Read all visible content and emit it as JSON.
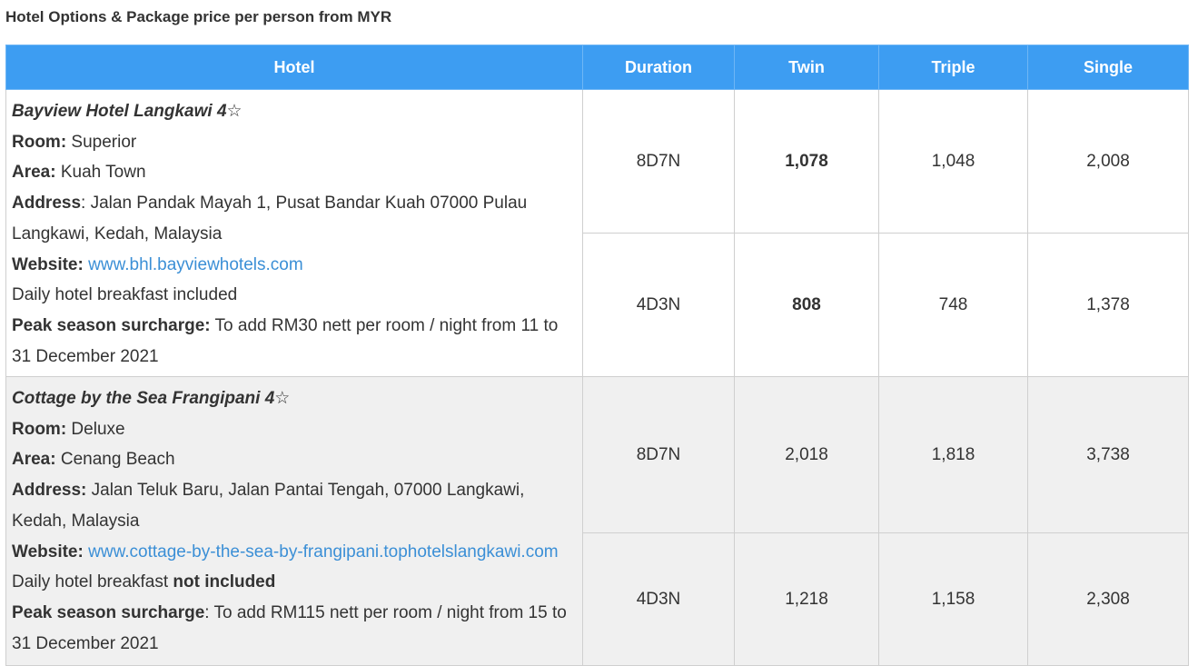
{
  "title": "Hotel Options & Package price per person from MYR",
  "table": {
    "headers": {
      "hotel": "Hotel",
      "duration": "Duration",
      "twin": "Twin",
      "triple": "Triple",
      "single": "Single"
    },
    "hotels": [
      {
        "name": "Bayview Hotel Langkawi 4☆",
        "room_label": "Room:",
        "room": " Superior",
        "area_label": "Area:",
        "area": " Kuah Town",
        "address_label": "Address",
        "address": ": Jalan Pandak Mayah 1, Pusat Bandar Kuah 07000 Pulau Langkawi, Kedah, Malaysia",
        "website_label": "Website:",
        "website": " www.bhl.bayviewhotels.com",
        "breakfast_prefix": "Daily hotel breakfast included",
        "breakfast_bold": "",
        "surcharge_label": "Peak season surcharge:",
        "surcharge": " To add RM30 nett per room / night from 11 to 31 December 2021",
        "rows": [
          {
            "duration": "8D7N",
            "twin": "1,078",
            "triple": "1,048",
            "single": "2,008"
          },
          {
            "duration": "4D3N",
            "twin": "808",
            "triple": "748",
            "single": "1,378"
          }
        ]
      },
      {
        "name": "Cottage by the Sea Frangipani 4☆",
        "room_label": "Room:",
        "room": " Deluxe",
        "area_label": "Area:",
        "area": " Cenang Beach",
        "address_label": "Address:",
        "address": " Jalan Teluk Baru, Jalan Pantai Tengah, 07000 Langkawi, Kedah, Malaysia",
        "website_label": "Website:",
        "website": " www.cottage-by-the-sea-by-frangipani.tophotelslangkawi.com",
        "breakfast_prefix": "Daily hotel breakfast ",
        "breakfast_bold": "not included",
        "surcharge_label": "Peak season surcharge",
        "surcharge": ": To add RM115 nett per room / night from 15 to 31 December 2021",
        "rows": [
          {
            "duration": "8D7N",
            "twin": "2,018",
            "triple": "1,818",
            "single": "3,738"
          },
          {
            "duration": "4D3N",
            "twin": "1,218",
            "triple": "1,158",
            "single": "2,308"
          }
        ]
      }
    ]
  },
  "colors": {
    "header_bg": "#3d9df2",
    "link": "#3b8fd6",
    "alt_row_bg": "#f0f0f0"
  }
}
